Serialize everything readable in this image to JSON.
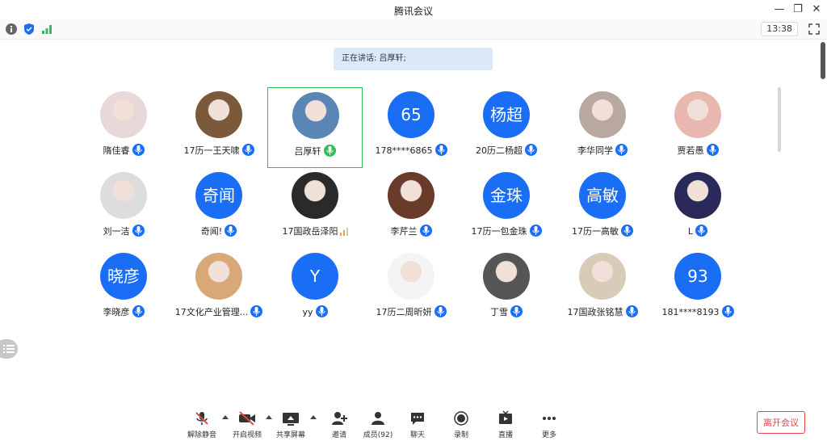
{
  "window": {
    "title": "腾讯会议"
  },
  "toolbar": {
    "time": "13:38"
  },
  "speaking": {
    "text": "正在讲话: 吕厚轩;"
  },
  "participants": [
    {
      "name": "隋佳睿",
      "avatar_text": "",
      "avatar_color": "#e8d8d8"
    },
    {
      "name": "17历一王天啸",
      "avatar_text": "",
      "avatar_color": "#7a5a3a"
    },
    {
      "name": "吕厚轩",
      "avatar_text": "",
      "avatar_color": "#5a86b6"
    },
    {
      "name": "178****6865",
      "avatar_text": "65",
      "avatar_color": "#1a6ef5"
    },
    {
      "name": "20历二杨超",
      "avatar_text": "杨超",
      "avatar_color": "#1a6ef5"
    },
    {
      "name": "李华同学",
      "avatar_text": "",
      "avatar_color": "#b8a8a0"
    },
    {
      "name": "贾若愚",
      "avatar_text": "",
      "avatar_color": "#e8b8b0"
    },
    {
      "name": "刘一洁",
      "avatar_text": "",
      "avatar_color": "#ddd"
    },
    {
      "name": "奇闻!",
      "avatar_text": "奇闻",
      "avatar_color": "#1a6ef5"
    },
    {
      "name": "17国政岳泽阳",
      "avatar_text": "",
      "avatar_color": "#2a2a2a"
    },
    {
      "name": "李芹兰",
      "avatar_text": "",
      "avatar_color": "#6a3a2a"
    },
    {
      "name": "17历一包金珠",
      "avatar_text": "金珠",
      "avatar_color": "#1a6ef5"
    },
    {
      "name": "17历一高敏",
      "avatar_text": "高敏",
      "avatar_color": "#1a6ef5"
    },
    {
      "name": "L",
      "avatar_text": "",
      "avatar_color": "#2a2a5a"
    },
    {
      "name": "李晓彦",
      "avatar_text": "晓彦",
      "avatar_color": "#1a6ef5"
    },
    {
      "name": "17文化产业管理...",
      "avatar_text": "",
      "avatar_color": "#d8a878"
    },
    {
      "name": "yy",
      "avatar_text": "Y",
      "avatar_color": "#1a6ef5"
    },
    {
      "name": "17历二周昕妍",
      "avatar_text": "",
      "avatar_color": "#f4f4f4"
    },
    {
      "name": "丁雪",
      "avatar_text": "",
      "avatar_color": "#555"
    },
    {
      "name": "17国政张铭慧",
      "avatar_text": "",
      "avatar_color": "#d8cbb8"
    },
    {
      "name": "181****8193",
      "avatar_text": "93",
      "avatar_color": "#1a6ef5"
    }
  ],
  "bottombar": {
    "unmute": "解除静音",
    "video": "开启视频",
    "share": "共享屏幕",
    "invite": "邀请",
    "members": "成员(92)",
    "chat": "聊天",
    "record": "录制",
    "live": "直播",
    "more": "更多",
    "leave": "离开会议"
  }
}
